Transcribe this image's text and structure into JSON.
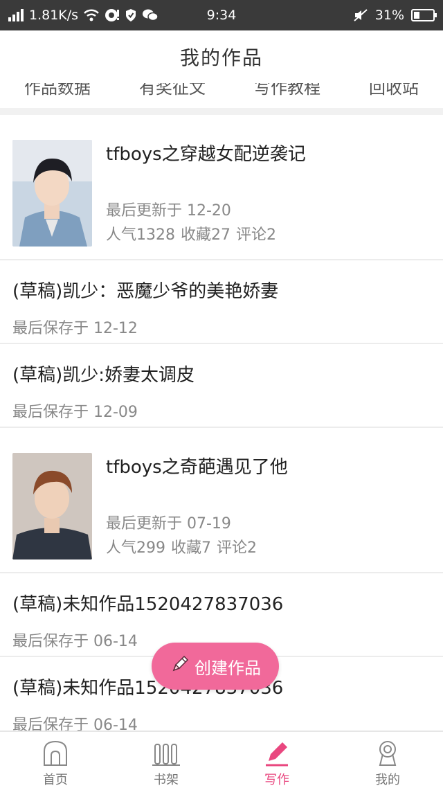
{
  "statusbar": {
    "speed": "1.81K/s",
    "time": "9:34",
    "battery_percent": "31%",
    "battery_level": 0.31
  },
  "header": {
    "title": "我的作品"
  },
  "tabs": [
    "作品数据",
    "有奖征文",
    "写作教程",
    "回收站"
  ],
  "works": [
    {
      "type": "published",
      "title": "tfboys之穿越女配逆袭记",
      "updated": "最后更新于 12-20",
      "popularity": "人气1328",
      "favorites": "收藏27",
      "comments": "评论2"
    },
    {
      "type": "draft",
      "title": "(草稿)凯少：恶魔少爷的美艳娇妻",
      "saved": "最后保存于 12-12"
    },
    {
      "type": "draft",
      "title": "(草稿)凯少:娇妻太调皮",
      "saved": "最后保存于 12-09"
    },
    {
      "type": "published",
      "title": "tfboys之奇葩遇见了他",
      "updated": "最后更新于 07-19",
      "popularity": "人气299",
      "favorites": "收藏7",
      "comments": "评论2"
    },
    {
      "type": "draft",
      "title": "(草稿)未知作品1520427837036",
      "saved": "最后保存于 06-14"
    },
    {
      "type": "draft",
      "title": "(草稿)未知作品1520427837036",
      "saved": "最后保存于 06-14"
    }
  ],
  "fab": {
    "label": "创建作品",
    "icon": "pencil-icon"
  },
  "bottom_nav": [
    {
      "label": "首页",
      "icon": "home-icon"
    },
    {
      "label": "书架",
      "icon": "bookshelf-icon"
    },
    {
      "label": "写作",
      "icon": "pencil-icon"
    },
    {
      "label": "我的",
      "icon": "profile-icon"
    }
  ],
  "colors": {
    "accent": "#f1699a",
    "active_nav": "#e9477f",
    "statusbar": "#3a3a3a"
  }
}
